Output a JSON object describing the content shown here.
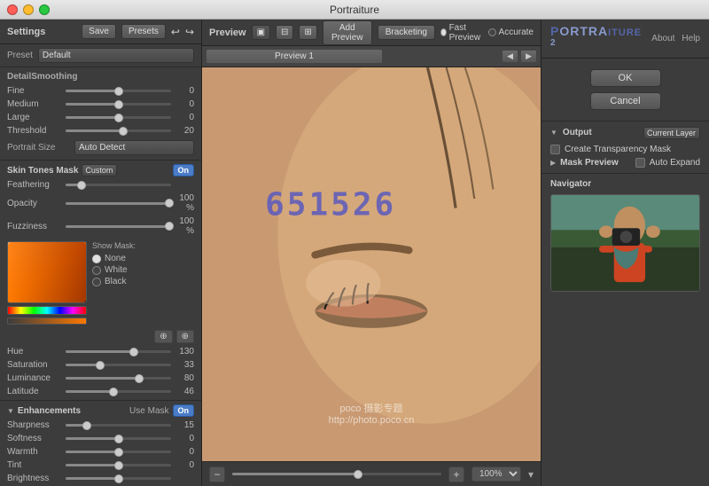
{
  "titleBar": {
    "title": "Portraiture"
  },
  "leftPanel": {
    "header": {
      "title": "Settings",
      "saveLabel": "Save",
      "presetsLabel": "Presets"
    },
    "preset": {
      "label": "Preset",
      "value": "Default"
    },
    "detailSmoothing": {
      "title": "DetailSmoothing",
      "sliders": [
        {
          "label": "Fine",
          "value": "0",
          "pct": 50
        },
        {
          "label": "Medium",
          "value": "0",
          "pct": 50
        },
        {
          "label": "Large",
          "value": "0",
          "pct": 50
        },
        {
          "label": "Threshold",
          "value": "20",
          "pct": 55
        }
      ],
      "portraitSize": {
        "label": "Portrait Size",
        "value": "Auto Detect"
      }
    },
    "skinTonesMask": {
      "title": "Skin Tones Mask",
      "dropdown": "Custom",
      "toggle": "On",
      "sliders": [
        {
          "label": "Feathering",
          "value": "",
          "pct": 15
        },
        {
          "label": "Opacity",
          "value": "100 %",
          "pct": 100
        },
        {
          "label": "Fuzziness",
          "value": "100 %",
          "pct": 100
        }
      ],
      "showMask": {
        "label": "Show Mask:",
        "options": [
          "None",
          "White",
          "Black"
        ],
        "selected": "None"
      },
      "hue": {
        "label": "Hue",
        "value": "130",
        "pct": 65
      },
      "saturation": {
        "label": "Saturation",
        "value": "33",
        "pct": 33
      },
      "luminance": {
        "label": "Luminance",
        "value": "80",
        "pct": 70
      },
      "latitude": {
        "label": "Latitude",
        "value": "46",
        "pct": 45
      }
    },
    "enhancements": {
      "title": "Enhancements",
      "useMaskLabel": "Use Mask",
      "toggle": "On",
      "sliders": [
        {
          "label": "Sharpness",
          "value": "15",
          "pct": 20
        },
        {
          "label": "Softness",
          "value": "0",
          "pct": 50
        },
        {
          "label": "Warmth",
          "value": "0",
          "pct": 50
        },
        {
          "label": "Tint",
          "value": "0",
          "pct": 50
        },
        {
          "label": "Brightness",
          "value": "",
          "pct": 50
        }
      ]
    }
  },
  "centerPanel": {
    "toolbar": {
      "previewLabel": "Preview",
      "icons": [
        "grid1",
        "grid2",
        "grid3"
      ],
      "addPreviewLabel": "Add Preview",
      "bracketingLabel": "Bracketing",
      "fastPreviewLabel": "Fast Preview",
      "accurateLabel": "Accurate"
    },
    "tabs": [
      {
        "label": "Preview 1",
        "active": true
      }
    ],
    "codeOverlay": "651526",
    "watermark": "poco 摄影专题\nhttp://photo.poco.cn",
    "zoomLevel": "100%"
  },
  "rightPanel": {
    "title": "PORTRAITURE",
    "titleHighlight": "ITURE",
    "version": "2",
    "links": [
      "About",
      "Help"
    ],
    "ok": "OK",
    "cancel": "Cancel",
    "output": {
      "label": "Output",
      "selectValue": "Current Layer",
      "createTransparency": "Create Transparency Mask",
      "maskPreview": "Mask Preview",
      "autoExpand": "Auto Expand"
    },
    "navigator": {
      "label": "Navigator"
    }
  }
}
